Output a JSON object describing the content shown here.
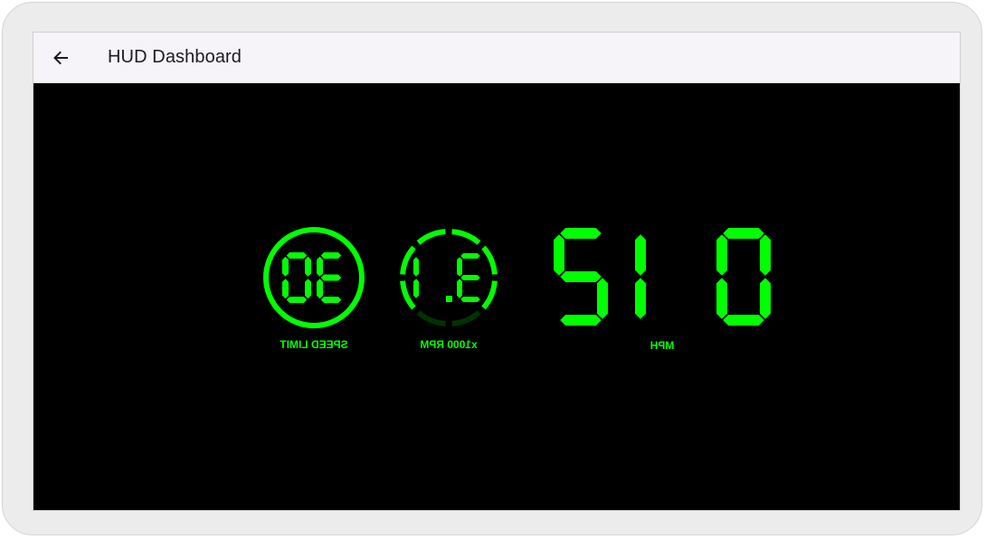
{
  "app_bar": {
    "title": "HUD Dashboard",
    "back_icon": "arrow-left-icon"
  },
  "hud": {
    "display_color": "#00ff00",
    "dim_color": "#003300",
    "speed_limit": {
      "value": "30",
      "label": "SPEED LIMIT"
    },
    "rpm": {
      "value": "3.1",
      "label": "x1000 RPM",
      "gauge_fraction": 0.75
    },
    "speed": {
      "value": "012",
      "label": "MPH"
    },
    "mirrored": true
  }
}
